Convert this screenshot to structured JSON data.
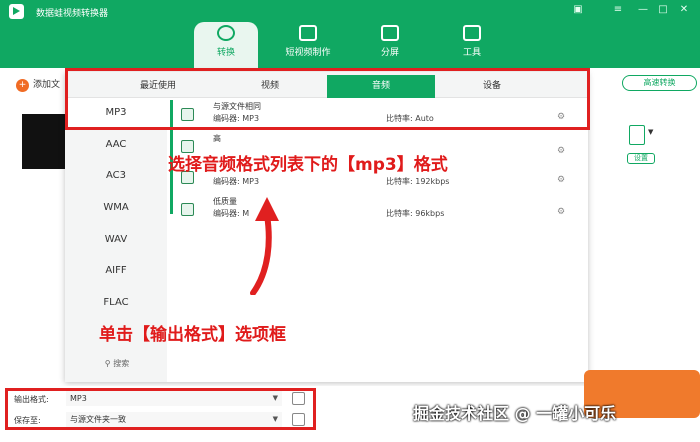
{
  "app": {
    "title": "数据蛙视频转换器"
  },
  "window_controls": [
    "window-menu-icon",
    "minimize-icon",
    "maximize-icon",
    "close-icon"
  ],
  "nav": [
    {
      "label": "转换",
      "icon": "convert-icon",
      "active": true
    },
    {
      "label": "短视频制作",
      "icon": "short-video-icon"
    },
    {
      "label": "分屏",
      "icon": "split-screen-icon"
    },
    {
      "label": "工具",
      "icon": "toolbox-icon"
    }
  ],
  "toolbar": {
    "add_file": "添加文",
    "high_speed": "高速转换",
    "settings": "设置"
  },
  "popup": {
    "tabs": [
      "最近使用",
      "视频",
      "音频",
      "设备"
    ],
    "active_tab": "音频",
    "formats": [
      "MP3",
      "AAC",
      "AC3",
      "WMA",
      "WAV",
      "AIFF",
      "FLAC"
    ],
    "selected_format": "MP3",
    "search": "搜索",
    "options": [
      {
        "quality": "与源文件相同",
        "encoder": "编码器:   MP3",
        "bitrate": "比特率:   Auto"
      },
      {
        "quality": "高",
        "encoder": "",
        "bitrate": ""
      },
      {
        "quality": "",
        "encoder": "编码器:   MP3",
        "bitrate": "比特率:   192kbps"
      },
      {
        "quality": "低质量",
        "encoder": "编码器:   M",
        "bitrate": "比特率:   96kbps"
      }
    ]
  },
  "bottom": {
    "output_format_label": "输出格式:",
    "output_format_value": "MP3",
    "save_to_label": "保存至:",
    "save_to_value": "与源文件夹一致"
  },
  "annotations": {
    "format_list_hint": "选择音频格式列表下的【mp3】格式",
    "output_format_hint": "单击【输出格式】选项框"
  },
  "watermark": "掘金技术社区 @ 一罐小可乐",
  "colors": {
    "brand": "#10a862",
    "annotation_red": "#e02020",
    "convert_orange": "#f07a2c"
  }
}
